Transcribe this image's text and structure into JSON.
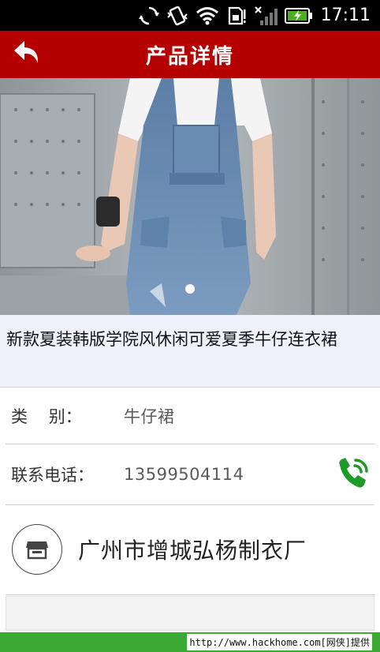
{
  "status_bar": {
    "time": "17:11",
    "battery_color": "#4caf20"
  },
  "header": {
    "title": "产品详情",
    "back_icon": "back-arrow-icon",
    "background": "#b40000"
  },
  "gallery": {
    "slide_count": 1,
    "active_index": 0
  },
  "product": {
    "name": "新款夏装韩版学院风休闲可爱夏季牛仔连衣裙"
  },
  "details": {
    "category_label": "类    别：",
    "category_value": "牛仔裙",
    "phone_label": "联系电话：",
    "phone_value": "13599504114",
    "call_icon": "phone-call-icon",
    "call_icon_color": "#1e9a2a"
  },
  "company": {
    "icon": "shop-icon",
    "name": "广州市增城弘杨制衣厂"
  },
  "watermark": {
    "text": "http://www.hackhome.com[网侠]提供",
    "background": "#3aaa35"
  }
}
